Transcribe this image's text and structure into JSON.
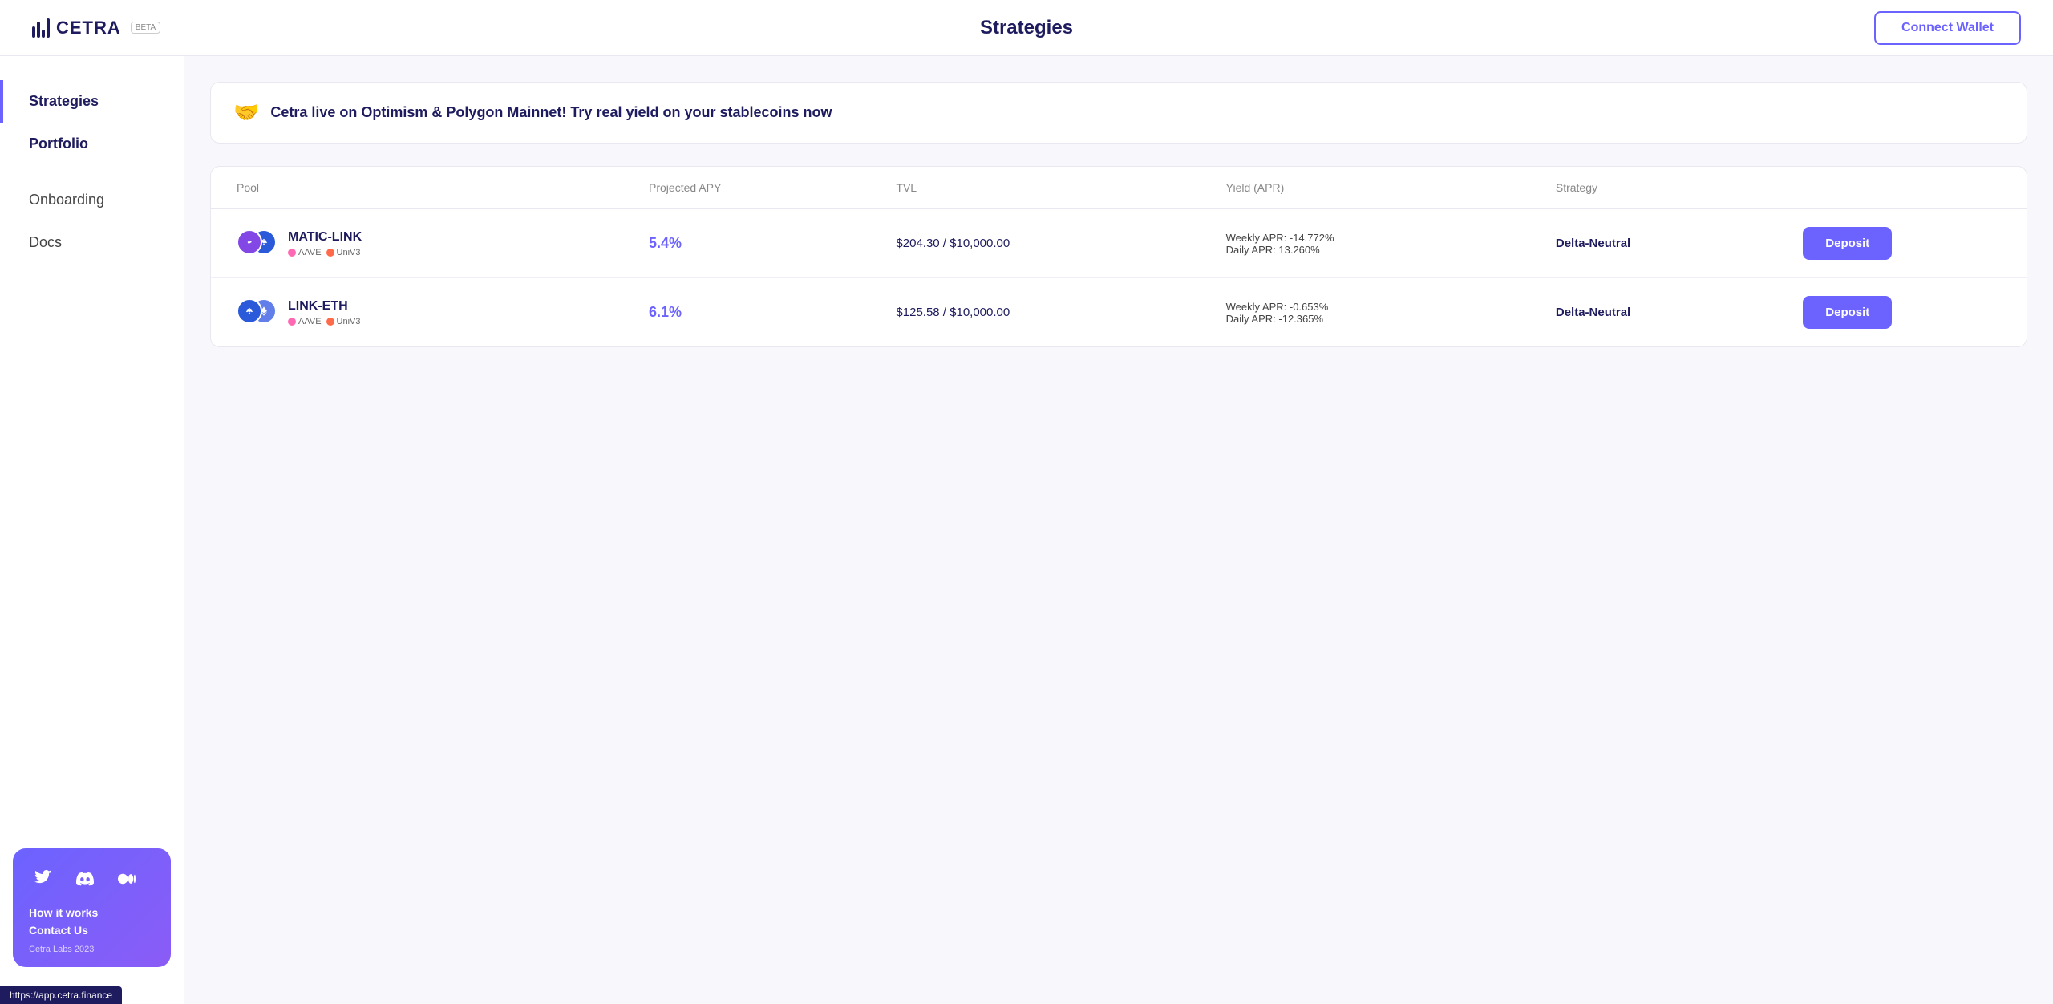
{
  "header": {
    "logo_text": "CETRA",
    "beta_label": "BETA",
    "title": "Strategies",
    "connect_wallet_label": "Connect Wallet"
  },
  "sidebar": {
    "items": [
      {
        "id": "strategies",
        "label": "Strategies",
        "active": true
      },
      {
        "id": "portfolio",
        "label": "Portfolio",
        "active": false
      },
      {
        "id": "onboarding",
        "label": "Onboarding",
        "active": false
      },
      {
        "id": "docs",
        "label": "Docs",
        "active": false
      }
    ],
    "social": {
      "twitter_icon": "🐦",
      "discord_icon": "💬",
      "medium_icon": "⏺",
      "how_it_works": "How it works",
      "contact_us": "Contact Us",
      "copyright": "Cetra Labs 2023"
    }
  },
  "banner": {
    "emoji": "🤝",
    "text": "Cetra live on Optimism & Polygon Mainnet! Try real yield on your stablecoins now"
  },
  "table": {
    "headers": {
      "pool": "Pool",
      "projected_apy": "Projected APY",
      "tvl": "TVL",
      "yield_apr": "Yield (APR)",
      "strategy": "Strategy",
      "action": ""
    },
    "rows": [
      {
        "pool_name": "MATIC-LINK",
        "pool_icon1_label": "MATIC",
        "pool_icon2_label": "LINK",
        "tag1": "AAVE",
        "tag1_color": "#FF69B4",
        "tag2": "UniV3",
        "tag2_color": "#FF6B4A",
        "projected_apy": "5.4%",
        "tvl": "$204.30 / $10,000.00",
        "weekly_apr": "Weekly APR: -14.772%",
        "daily_apr": "Daily APR: 13.260%",
        "strategy": "Delta-Neutral",
        "deposit_label": "Deposit"
      },
      {
        "pool_name": "LINK-ETH",
        "pool_icon1_label": "LINK",
        "pool_icon2_label": "ETH",
        "tag1": "AAVE",
        "tag1_color": "#FF69B4",
        "tag2": "UniV3",
        "tag2_color": "#FF6B4A",
        "projected_apy": "6.1%",
        "tvl": "$125.58 / $10,000.00",
        "weekly_apr": "Weekly APR: -0.653%",
        "daily_apr": "Daily APR: -12.365%",
        "strategy": "Delta-Neutral",
        "deposit_label": "Deposit"
      }
    ]
  },
  "url_bar": {
    "url": "https://app.cetra.finance"
  }
}
